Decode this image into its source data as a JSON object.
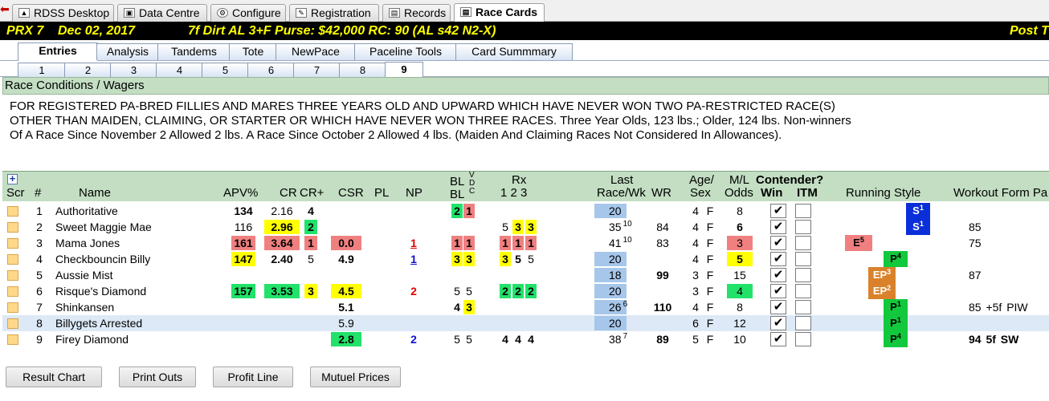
{
  "top_tabs": [
    {
      "label": "RDSS Desktop",
      "icon": "desktop-icon"
    },
    {
      "label": "Data Centre",
      "icon": "data-centre-icon"
    },
    {
      "label": "Configure",
      "icon": "gear-icon"
    },
    {
      "label": "Registration",
      "icon": "registration-icon"
    },
    {
      "label": "Records",
      "icon": "records-icon"
    },
    {
      "label": "Race Cards",
      "icon": "race-cards-icon",
      "active": true
    }
  ],
  "race_bar": {
    "race": "PRX  7",
    "date": "Dec 02, 2017",
    "conditions": "7f  Dirt   AL  3+F   Purse: $42,000   RC: 90  (AL s42 N2-X)",
    "post": "Post T"
  },
  "sub_tabs": [
    "Entries",
    "Analysis",
    "Tandems",
    "Tote",
    "NewPace",
    "Paceline Tools",
    "Card Summmary"
  ],
  "race_tabs": [
    "1",
    "2",
    "3",
    "4",
    "5",
    "6",
    "7",
    "8",
    "9"
  ],
  "conditions": {
    "header": "Race Conditions / Wagers",
    "text": "FOR REGISTERED PA-BRED FILLIES AND MARES THREE YEARS OLD  AND UPWARD WHICH HAVE NEVER WON TWO PA-RESTRICTED RACE(S) OTHER THAN MAIDEN, CLAIMING, OR STARTER OR WHICH HAVE NEVER WON THREE RACES. Three Year Olds, 123 lbs.; Older, 124 lbs. Non-winners Of A Race Since November 2 Allowed 2 lbs. A Race Since October 2 Allowed 4 lbs. (Maiden And Claiming Races Not Considered In Allowances)."
  },
  "headers": {
    "plus": "+",
    "scr": "Scr",
    "num": "#",
    "name": "Name",
    "apv": "APV%",
    "cr": "CR",
    "crp": "CR+",
    "csr": "CSR",
    "pl": "PL",
    "np": "NP",
    "bl1": "BL",
    "bl2": "BL",
    "vdc": "V D C",
    "rx": "Rx",
    "rx123": "1  2  3",
    "last1": "Last",
    "last2": "Race/Wk",
    "wr": "WR",
    "age1": "Age/",
    "age2": "Sex",
    "ml1": "M/L",
    "ml2": "Odds",
    "contender": "Contender?",
    "win": "Win",
    "itm": "ITM",
    "rs": "Running Style",
    "wf": "Workout Form Pa"
  },
  "rows": [
    {
      "num": "1",
      "name": "Authoritative",
      "apv": "134",
      "cr": "2.16",
      "crp": "4",
      "csr": "",
      "np": "",
      "bl": [
        "2",
        "1"
      ],
      "rx": [
        "",
        "",
        ""
      ],
      "last": "20",
      "lastwk": "",
      "wr": "",
      "age": "4",
      "sex": "F",
      "ml": "8",
      "win": "✔",
      "rs": "S",
      "rsn": "1",
      "wf": ""
    },
    {
      "num": "2",
      "name": "Sweet Maggie Mae",
      "apv": "116",
      "cr": "2.96",
      "crp": "2",
      "csr": "",
      "np": "",
      "bl": [
        "",
        ""
      ],
      "rx": [
        "5",
        "3",
        "3"
      ],
      "last": "35",
      "lastwk": "10",
      "wr": "84",
      "age": "4",
      "sex": "F",
      "ml": "6",
      "win": "✔",
      "rs": "S",
      "rsn": "1",
      "wf": "85"
    },
    {
      "num": "3",
      "name": "Mama Jones",
      "apv": "161",
      "cr": "3.64",
      "crp": "1",
      "csr": "0.0",
      "np": "1",
      "bl": [
        "1",
        "1"
      ],
      "rx": [
        "1",
        "1",
        "1"
      ],
      "last": "41",
      "lastwk": "10",
      "wr": "83",
      "age": "4",
      "sex": "F",
      "ml": "3",
      "win": "✔",
      "rs": "E",
      "rsn": "5",
      "wf": "75"
    },
    {
      "num": "4",
      "name": "Checkbouncin Billy",
      "apv": "147",
      "cr": "2.40",
      "crp": "5",
      "csr": "4.9",
      "np": "1",
      "bl": [
        "3",
        "3"
      ],
      "rx": [
        "3",
        "5",
        "5"
      ],
      "last": "20",
      "lastwk": "",
      "wr": "",
      "age": "4",
      "sex": "F",
      "ml": "5",
      "win": "✔",
      "rs": "P",
      "rsn": "4",
      "wf": ""
    },
    {
      "num": "5",
      "name": "Aussie Mist",
      "apv": "",
      "cr": "",
      "crp": "",
      "csr": "",
      "np": "",
      "bl": [
        "",
        ""
      ],
      "rx": [
        "",
        "",
        ""
      ],
      "last": "18",
      "lastwk": "",
      "wr": "99",
      "age": "3",
      "sex": "F",
      "ml": "15",
      "win": "✔",
      "rs": "EP",
      "rsn": "3",
      "wf": "87"
    },
    {
      "num": "6",
      "name": "Risque's Diamond",
      "apv": "157",
      "cr": "3.53",
      "crp": "3",
      "csr": "4.5",
      "np": "2",
      "bl": [
        "5",
        "5"
      ],
      "rx": [
        "2",
        "2",
        "2"
      ],
      "last": "20",
      "lastwk": "",
      "wr": "",
      "age": "3",
      "sex": "F",
      "ml": "4",
      "win": "✔",
      "rs": "EP",
      "rsn": "2",
      "wf": ""
    },
    {
      "num": "7",
      "name": "Shinkansen",
      "apv": "",
      "cr": "",
      "crp": "",
      "csr": "5.1",
      "np": "",
      "bl": [
        "4",
        "3"
      ],
      "rx": [
        "",
        "",
        ""
      ],
      "last": "26",
      "lastwk": "6",
      "wr": "110",
      "age": "4",
      "sex": "F",
      "ml": "8",
      "win": "✔",
      "rs": "P",
      "rsn": "1",
      "wf": "85  +5f  PIW"
    },
    {
      "num": "8",
      "name": "Billygets Arrested",
      "apv": "",
      "cr": "",
      "crp": "",
      "csr": "5.9",
      "np": "",
      "bl": [
        "",
        ""
      ],
      "rx": [
        "",
        "",
        ""
      ],
      "last": "20",
      "lastwk": "",
      "wr": "",
      "age": "6",
      "sex": "F",
      "ml": "12",
      "win": "✔",
      "rs": "P",
      "rsn": "1",
      "wf": ""
    },
    {
      "num": "9",
      "name": "Firey Diamond",
      "apv": "",
      "cr": "",
      "crp": "",
      "csr": "2.8",
      "np": "2",
      "bl": [
        "5",
        "5"
      ],
      "rx": [
        "4",
        "4",
        "4"
      ],
      "last": "38",
      "lastwk": "7",
      "wr": "89",
      "age": "5",
      "sex": "F",
      "ml": "10",
      "win": "✔",
      "rs": "P",
      "rsn": "4",
      "wf": "94  5f  SW"
    }
  ],
  "buttons": [
    "Result Chart",
    "Print Outs",
    "Profit Line",
    "Mutuel Prices"
  ],
  "colors": {
    "green": "#22e26a",
    "yellow": "#ffff00",
    "red": "#f08080",
    "blue_cell": "#a6c6ea",
    "style_S": "#0a2fd8",
    "style_E": "#f08080",
    "style_P": "#12c83c",
    "style_EP": "#d9822b",
    "header_green": "#c3dec3",
    "race_bar_text": "#ffff00"
  }
}
